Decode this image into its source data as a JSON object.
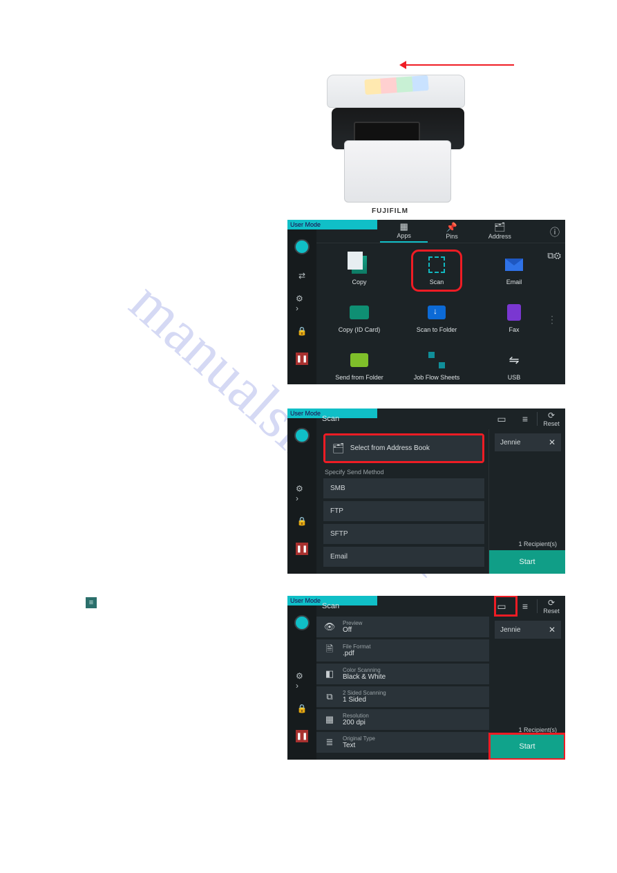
{
  "watermark": "manualslive.com",
  "printer": {
    "brand": "FUJIFILM"
  },
  "home_screen": {
    "user_mode": "User Mode",
    "top_tabs": {
      "apps": {
        "label": "Apps",
        "icon": "grid"
      },
      "pins": {
        "label": "Pins",
        "icon": "pin"
      },
      "address": {
        "label": "Address",
        "icon": "address"
      }
    },
    "apps": {
      "copy": {
        "label": "Copy"
      },
      "scan": {
        "label": "Scan"
      },
      "email": {
        "label": "Email"
      },
      "copy_id": {
        "label": "Copy (ID Card)"
      },
      "scan_to_folder": {
        "label": "Scan to Folder"
      },
      "fax": {
        "label": "Fax"
      },
      "send_folder": {
        "label": "Send from Folder"
      },
      "job_flow": {
        "label": "Job Flow Sheets"
      },
      "usb": {
        "label": "USB"
      }
    }
  },
  "scan_dest_screen": {
    "user_mode": "User Mode",
    "title": "Scan",
    "reset": "Reset",
    "address_book": "Select from Address Book",
    "specify_label": "Specify Send Method",
    "methods": {
      "smb": "SMB",
      "ftp": "FTP",
      "sftp": "SFTP",
      "email": "Email"
    },
    "recipient_name": "Jennie",
    "recipient_count": "1 Recipient(s)",
    "start": "Start"
  },
  "scan_settings_screen": {
    "user_mode": "User Mode",
    "title": "Scan",
    "reset": "Reset",
    "recipient_name": "Jennie",
    "recipient_count": "1 Recipient(s)",
    "start": "Start",
    "settings": {
      "preview": {
        "label": "Preview",
        "value": "Off"
      },
      "file_format": {
        "label": "File Format",
        "value": ".pdf"
      },
      "color": {
        "label": "Color Scanning",
        "value": "Black & White"
      },
      "twosided": {
        "label": "2 Sided Scanning",
        "value": "1 Sided"
      },
      "resolution": {
        "label": "Resolution",
        "value": "200 dpi"
      },
      "orig_type": {
        "label": "Original Type",
        "value": "Text"
      }
    }
  }
}
